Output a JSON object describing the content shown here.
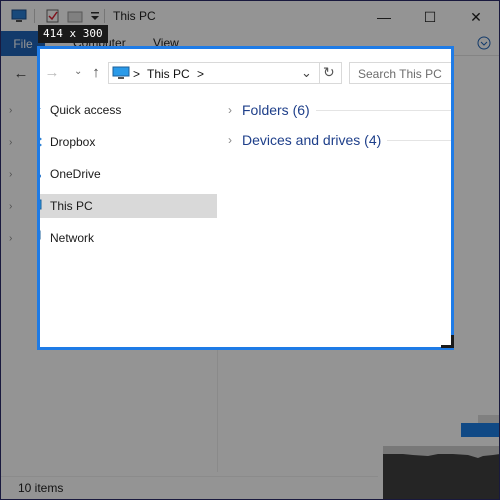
{
  "window": {
    "title": "This PC",
    "tabs": [
      "File",
      "Computer",
      "View"
    ],
    "minimize": "—",
    "maximize": "☐",
    "close": "✕"
  },
  "address": {
    "crumb_separator_1": ">",
    "location": "This PC",
    "crumb_separator_2": ">",
    "search_placeholder": "Search This PC"
  },
  "nav": {
    "items": [
      {
        "label": "Quick access",
        "icon": "star-icon"
      },
      {
        "label": "Dropbox",
        "icon": "dropbox-icon"
      },
      {
        "label": "OneDrive",
        "icon": "cloud-icon"
      },
      {
        "label": "This PC",
        "icon": "computer-icon",
        "selected": true
      },
      {
        "label": "Network",
        "icon": "network-icon"
      }
    ]
  },
  "content": {
    "sections": [
      {
        "label": "Folders (6)"
      },
      {
        "label": "Devices and drives (4)"
      }
    ]
  },
  "status": {
    "items_count": "10 items"
  },
  "capture": {
    "size_label": "414 x 300"
  },
  "colors": {
    "accent": "#1e7be6",
    "file_tab": "#1f64b8",
    "section_text": "#1e3f8a",
    "selected_item": "#cce8ff"
  }
}
